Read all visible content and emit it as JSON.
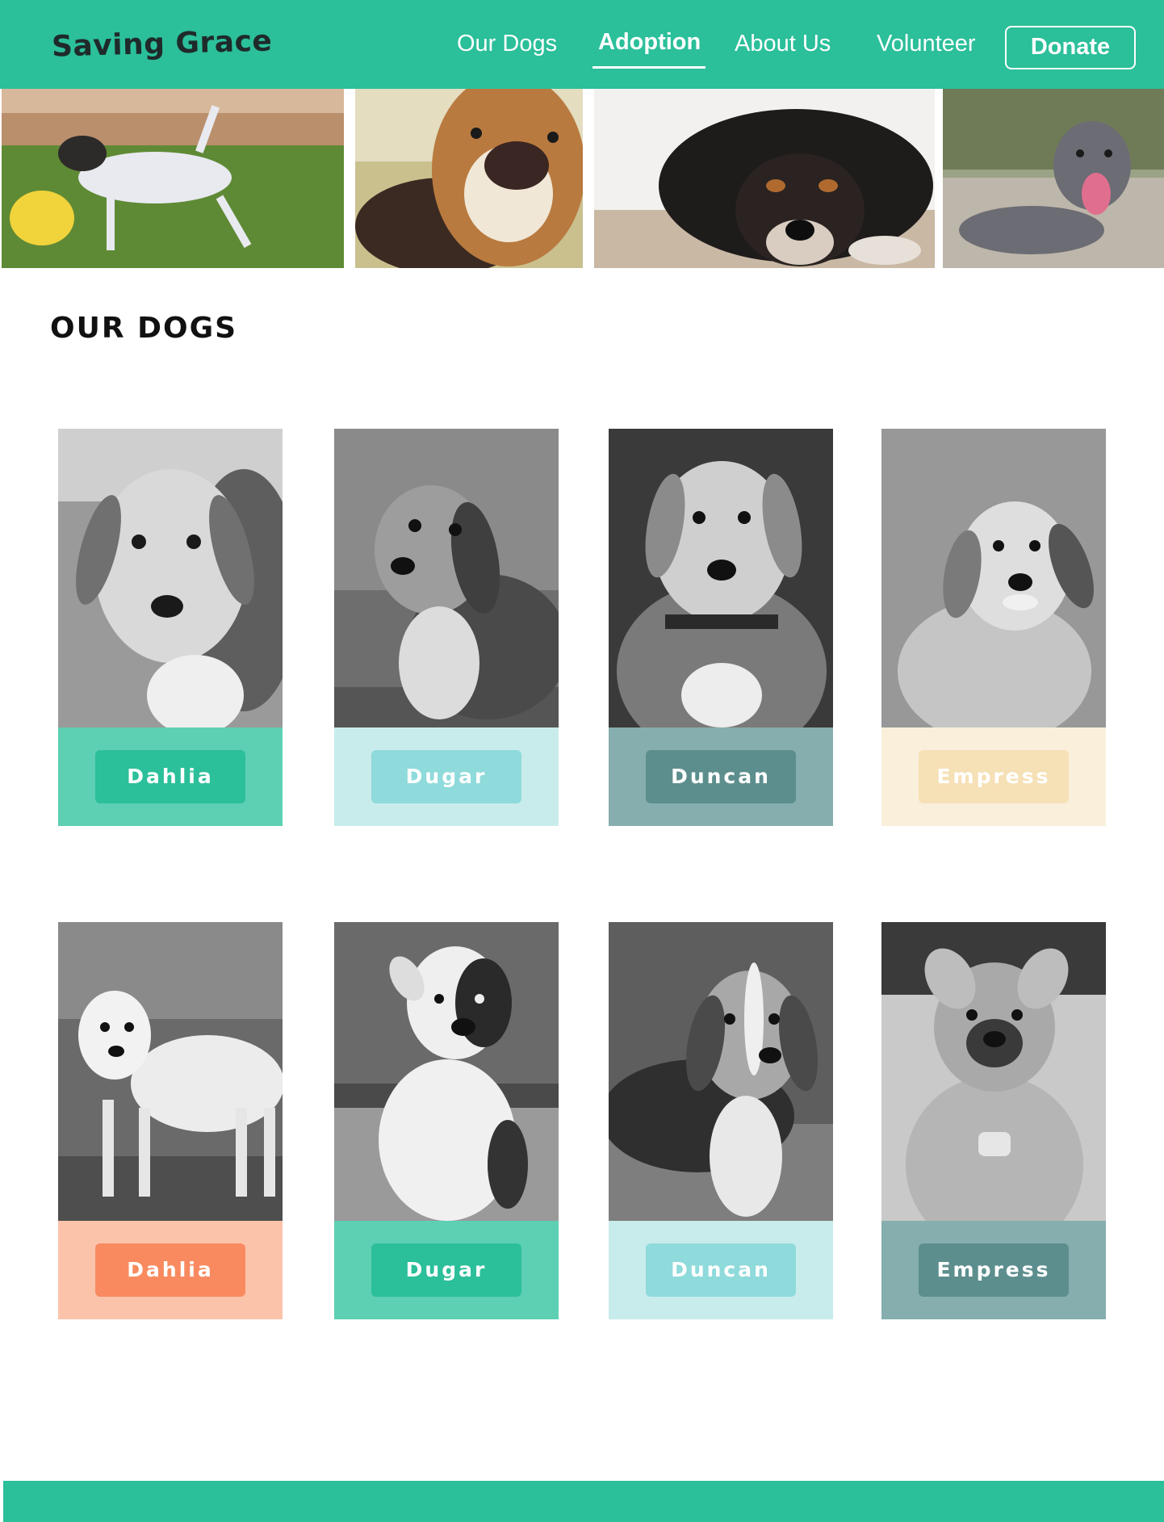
{
  "header": {
    "logo": "Saving Grace",
    "nav": [
      {
        "label": "Our Dogs"
      },
      {
        "label": "Adoption"
      },
      {
        "label": "About Us"
      },
      {
        "label": "Volunteer"
      }
    ],
    "active_nav": "Adoption",
    "donate_label": "Donate",
    "bg_color": "#2bbf9a"
  },
  "section_title": "OUR DOGS",
  "dogs": [
    {
      "name": "Dahlia"
    },
    {
      "name": "Dugar"
    },
    {
      "name": "Duncan"
    },
    {
      "name": "Empress"
    },
    {
      "name": "Dahlia"
    },
    {
      "name": "Dugar"
    },
    {
      "name": "Duncan"
    },
    {
      "name": "Empress"
    }
  ],
  "palette": {
    "green_footer": "#5dcfb2",
    "green_button": "#2bbf9a",
    "green_text": "#ffffff",
    "aqua_footer": "#c8ecec",
    "aqua_button": "#8fdadb",
    "aqua_text": "#ffffff",
    "slate_footer": "#86aeae",
    "slate_button": "#5d8e8e",
    "slate_text": "#ffffff",
    "cream_footer": "#faefdb",
    "cream_button": "#f6e0b6",
    "cream_text": "#ffffff",
    "peach_footer": "#fcc3ab",
    "peach_button": "#f98a60",
    "peach_text": "#ffffff"
  }
}
